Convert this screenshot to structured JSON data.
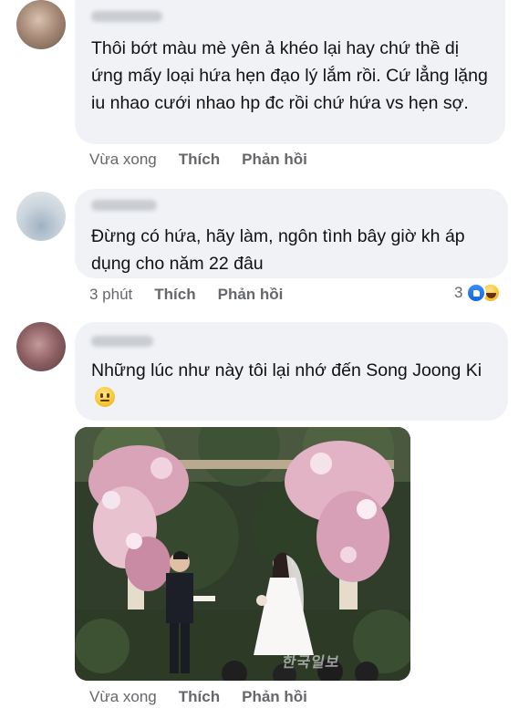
{
  "comments": [
    {
      "text": "Thôi bớt màu mè yên ả khéo lại hay chứ thề dị ứng mấy loại hứa hẹn đạo lý lắm rồi. Cứ lẳng lặng iu nhao cưới nhao hp đc rồi chứ hứa vs hẹn sợ.",
      "time": "Vừa xong",
      "like_label": "Thích",
      "reply_label": "Phản hồi"
    },
    {
      "text": "Đừng có hứa, hãy làm, ngôn tình bây giờ kh áp dụng cho năm 22 đâu",
      "time": "3 phút",
      "like_label": "Thích",
      "reply_label": "Phản hồi",
      "reaction_count": "3",
      "reaction_icons": [
        "like-icon",
        "haha-icon"
      ]
    },
    {
      "text": "Những lúc như này tôi lại nhớ đến Song Joong Ki",
      "emoji": "neutral-face-icon",
      "time": "Vừa xong",
      "like_label": "Thích",
      "reply_label": "Phản hồi",
      "photo_watermark": "한국일보"
    }
  ],
  "colors": {
    "bubble": "#f0f2f5",
    "meta_text": "#65676b",
    "like_blue": "#1877f2"
  }
}
